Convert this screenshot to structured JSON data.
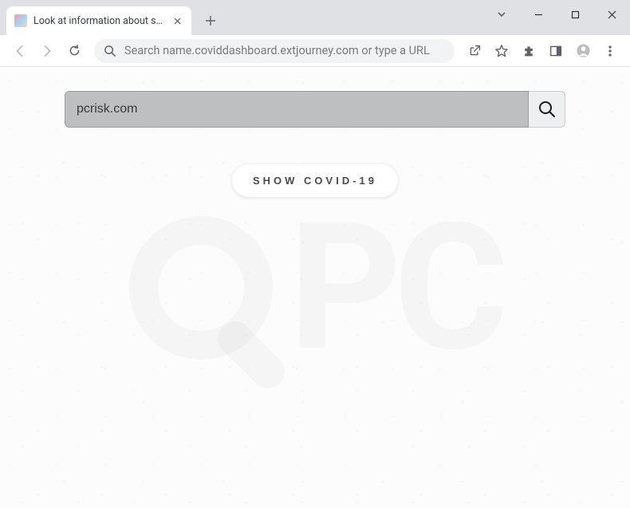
{
  "window": {
    "tab_title": "Look at information about spread",
    "new_tab_label": "+"
  },
  "omnibox": {
    "placeholder": "Search name.coviddashboard.extjourney.com or type a URL"
  },
  "page": {
    "search_value": "pcrisk.com",
    "show_button_label": "SHOW COVID-19",
    "watermark_text": "PC"
  },
  "icons": {
    "close": "close-icon",
    "plus": "plus-icon",
    "chevron": "chevron-down-icon",
    "minimize": "minimize-icon",
    "maximize": "maximize-icon",
    "x": "window-close-icon",
    "back": "back-icon",
    "forward": "forward-icon",
    "reload": "reload-icon",
    "search": "search-icon",
    "share": "share-icon",
    "star": "star-icon",
    "puzzle": "extensions-icon",
    "panel": "side-panel-icon",
    "profile": "profile-icon",
    "menu": "menu-icon",
    "magnify": "magnify-icon"
  }
}
